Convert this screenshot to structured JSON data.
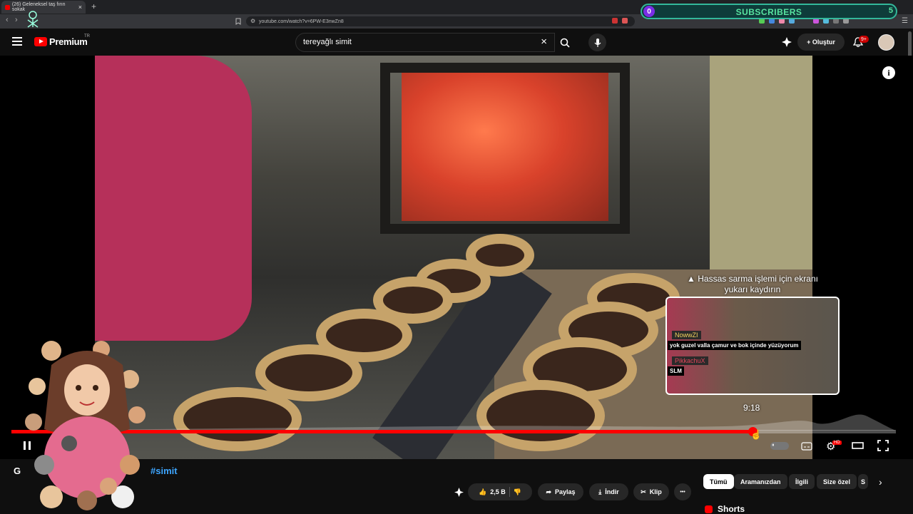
{
  "browser": {
    "tab_title": "(26) Geleneksel taş fırın sokak",
    "tab_close": "×",
    "new_tab": "+",
    "url": "youtube.com/watch?v=6PW-E3nwZn8"
  },
  "overlay": {
    "subs_label": "SUBSCRIBERS",
    "subs_left": "0",
    "subs_right": "5"
  },
  "header": {
    "brand": "Premium",
    "region": "TR",
    "search_value": "tereyağlı simit",
    "search_clear": "×",
    "create_label": "+ Oluştur",
    "notif_count": "9+"
  },
  "video": {
    "info": "i",
    "hint": "Hassas sarma işlemi için ekranı yukarı kaydırın",
    "chat": [
      {
        "name": "NowwZI",
        "message": "yok guzel valla çamur ve bok içinde yüzüyorum"
      },
      {
        "name": "PikkachuX",
        "message": "SLM"
      }
    ],
    "hover_time": "9:18",
    "progress_fraction": 0.838,
    "hd_badge": "HD"
  },
  "below": {
    "title_start": "G",
    "hashtag": "#simit",
    "actions": {
      "likes": "2,5 B",
      "share": "Paylaş",
      "download": "İndir",
      "clip": "Klip",
      "more": "•••"
    },
    "chips": [
      "Tümü",
      "Aramanızdan",
      "İlgili",
      "Size özel",
      "S"
    ],
    "shorts": "Shorts"
  },
  "colors": {
    "accent": "#ff0000",
    "subs_border": "#33b89a",
    "subs_text": "#58e3a0",
    "hashtag": "#3ea6ff"
  }
}
